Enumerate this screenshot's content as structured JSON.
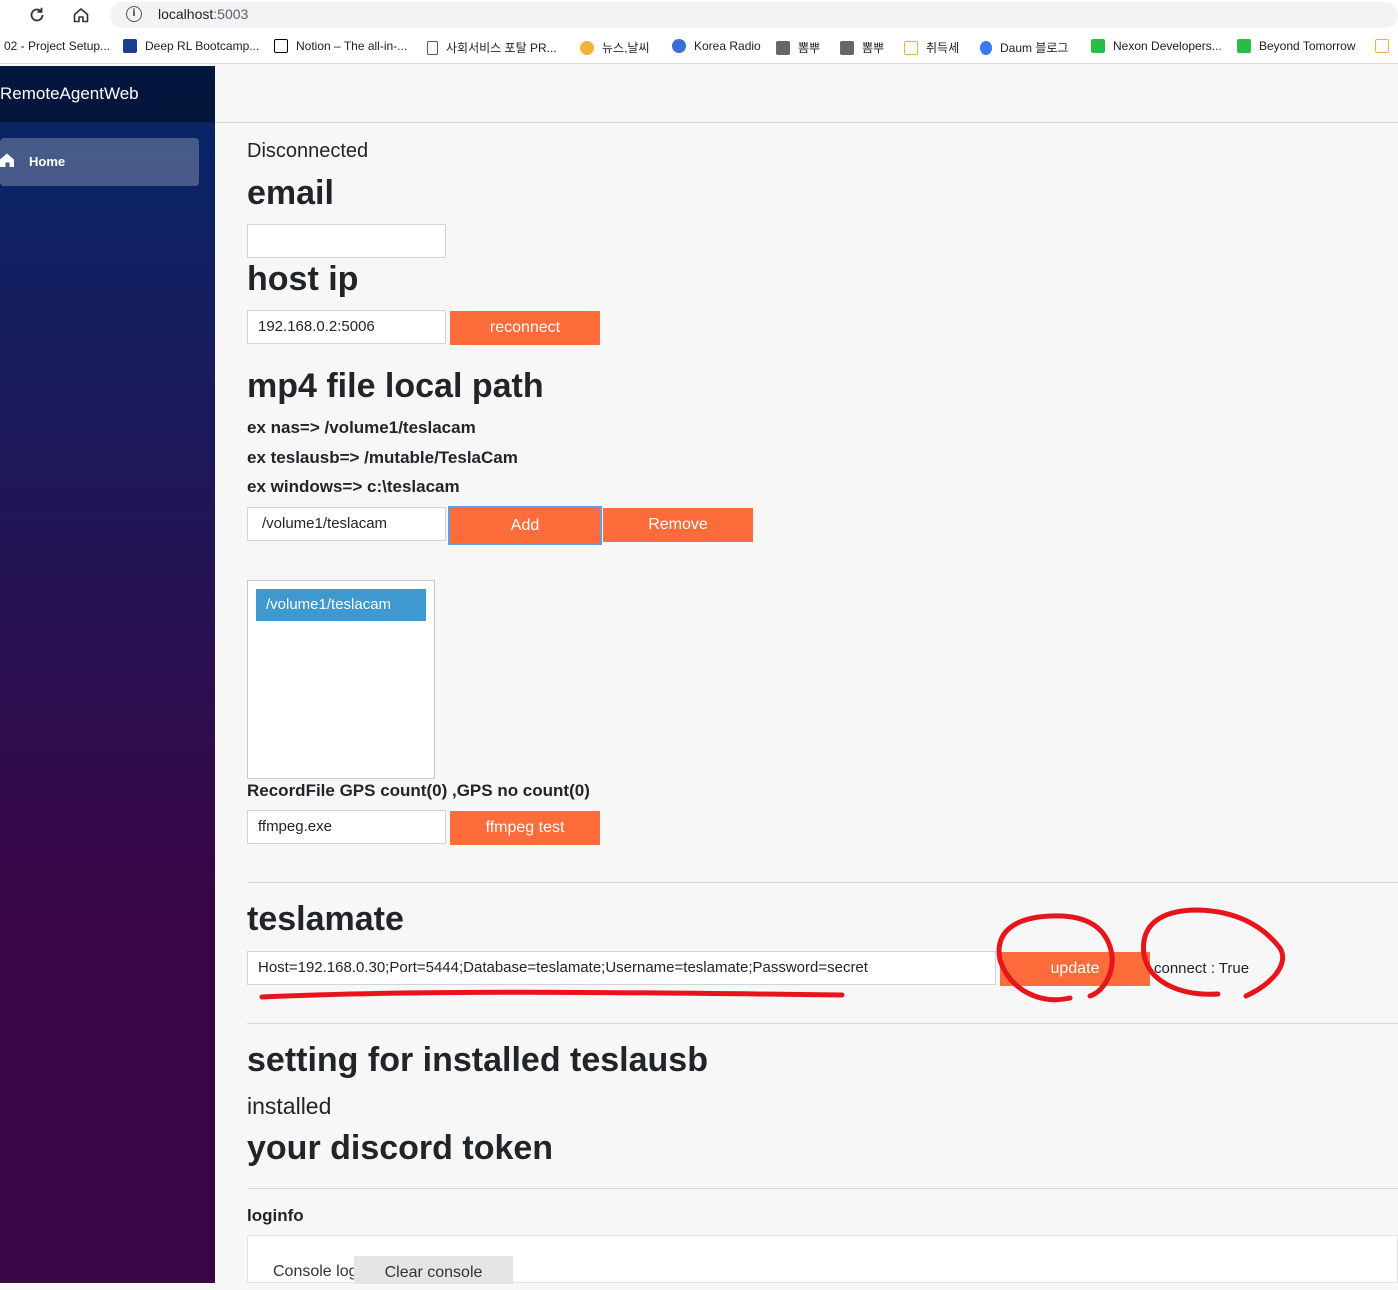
{
  "browser": {
    "url_host": "localhost",
    "url_port": ":5003",
    "bookmarks": [
      {
        "label": "02 - Project Setup...",
        "icon_color": ""
      },
      {
        "label": "Deep RL Bootcamp...",
        "icon_color": "#1a3f8f"
      },
      {
        "label": "Notion – The all-in-...",
        "icon_color": "#000000"
      },
      {
        "label": "사회서비스 포탈 PR...",
        "icon_color": "#777777"
      },
      {
        "label": "뉴스,날씨",
        "icon_color": "#f2b33d"
      },
      {
        "label": "Korea Radio",
        "icon_color": "#3b6fd4"
      },
      {
        "label": "뽐뿌",
        "icon_color": "#666666"
      },
      {
        "label": "뽐뿌",
        "icon_color": "#666666"
      },
      {
        "label": "취득세",
        "icon_color": "#e8b43a"
      },
      {
        "label": "Daum 블로그",
        "icon_color": "#3c78f0"
      },
      {
        "label": "Nexon Developers...",
        "icon_color": "#2dbb47"
      },
      {
        "label": "Beyond Tomorrow",
        "icon_color": "#2dbb47"
      }
    ]
  },
  "sidebar": {
    "brand": "RemoteAgentWeb",
    "nav_home": "Home"
  },
  "main": {
    "status": "Disconnected",
    "email_heading": "email",
    "email_value": "",
    "host_heading": "host ip",
    "host_value": "192.168.0.2:5006",
    "reconnect_label": "reconnect",
    "mp4_heading": "mp4 file local path",
    "ex_nas": "ex nas=> /volume1/teslacam",
    "ex_teslausb": "ex teslausb=> /mutable/TeslaCam",
    "ex_windows": "ex windows=> c:\\teslacam",
    "path_value": "/volume1/teslacam",
    "add_label": "Add",
    "remove_label": "Remove",
    "path_list": [
      "/volume1/teslacam"
    ],
    "record_info": "RecordFile GPS count(0) ,GPS no count(0)",
    "ffmpeg_value": "ffmpeg.exe",
    "ffmpeg_test_label": "ffmpeg test",
    "teslamate_heading": "teslamate",
    "teslamate_conn": "Host=192.168.0.30;Port=5444;Database=teslamate;Username=teslamate;Password=secret",
    "update_label": "update",
    "connect_status": "connect : True",
    "teslausb_heading": "setting for installed teslausb",
    "installed_label": "installed",
    "discord_heading": "your discord token",
    "loginfo_label": "loginfo",
    "console_log_label": "Console log",
    "clear_console_label": "Clear console"
  },
  "colors": {
    "accent_button": "#ff6c3b",
    "list_selected": "#3f98d0",
    "annotation_red": "#e8141c"
  }
}
